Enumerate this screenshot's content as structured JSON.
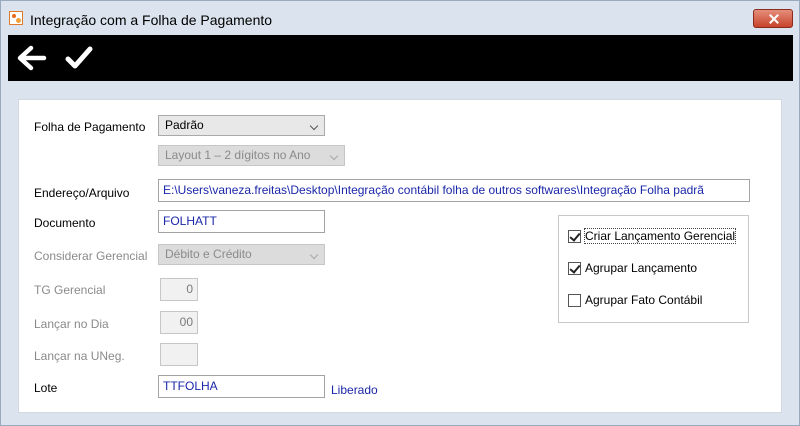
{
  "window": {
    "title": "Integração com a Folha de Pagamento",
    "close_icon": "close-x-icon"
  },
  "toolbar": {
    "back_icon": "arrow-left-icon",
    "confirm_icon": "check-icon"
  },
  "form": {
    "folha_label": "Folha de Pagamento",
    "folha_value": "Padrão",
    "layout_value": "Layout 1 – 2 dígitos no Ano",
    "endereco_label": "Endereço/Arquivo",
    "endereco_value": "E:\\Users\\vaneza.freitas\\Desktop\\Integração contábil folha de outros softwares\\Integração Folha padrã",
    "documento_label": "Documento",
    "documento_value": "FOLHATT",
    "gerencial_label": "Considerar Gerencial",
    "gerencial_value": "Débito e Crédito",
    "tg_label": "TG Gerencial",
    "tg_value": "0",
    "dia_label": "Lançar no Dia",
    "dia_value": "00",
    "uneg_label": "Lançar na UNeg.",
    "uneg_value": "",
    "lote_label": "Lote",
    "lote_value": "TTFOLHA",
    "lote_status": "Liberado"
  },
  "options": {
    "criar_label": "Criar Lançamento Gerencial",
    "criar_checked": true,
    "agrupar_label": "Agrupar Lançamento",
    "agrupar_checked": true,
    "fato_label": "Agrupar Fato Contábil",
    "fato_checked": false
  }
}
